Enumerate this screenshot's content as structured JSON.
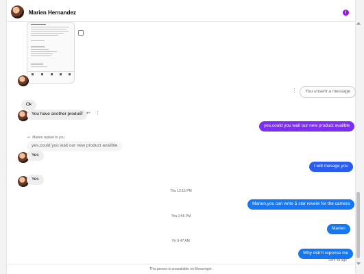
{
  "contact": {
    "name": "Marien Hernandez"
  },
  "icons": {
    "info": "info-icon",
    "share": "share-icon",
    "more": "more-options-icon",
    "emoji": "emoji-reaction-icon",
    "reply": "reply-icon"
  },
  "colors": {
    "info": "#a10ff5",
    "out_purple": "#7c2ff0",
    "out_blue": "#1677f2",
    "out_blue2": "#2b5cf0"
  },
  "messages": {
    "unsent_label": "You unsent a message",
    "ok": "Ok",
    "another_product": "You have another product",
    "wait_new": "yes,could you wait our new product availble",
    "replied_to_label": "Marien replied to you",
    "quoted": "yes,could you wait our new product availble",
    "yes1": "Yes",
    "will_message": "I will mesage you",
    "yes2": "Yes",
    "time1": "Thu 12:15 PM",
    "five_star": "Marien,you can write 5 star reveiw for the camera",
    "time2": "Thu 2:55 PM",
    "marien": "Marien",
    "time3": "Fri 9:47 AM",
    "why": "Why didn't reponse me",
    "sent_status": "Sent 4d ago"
  },
  "footer": {
    "text": "This person is unavailable on Messenger."
  }
}
